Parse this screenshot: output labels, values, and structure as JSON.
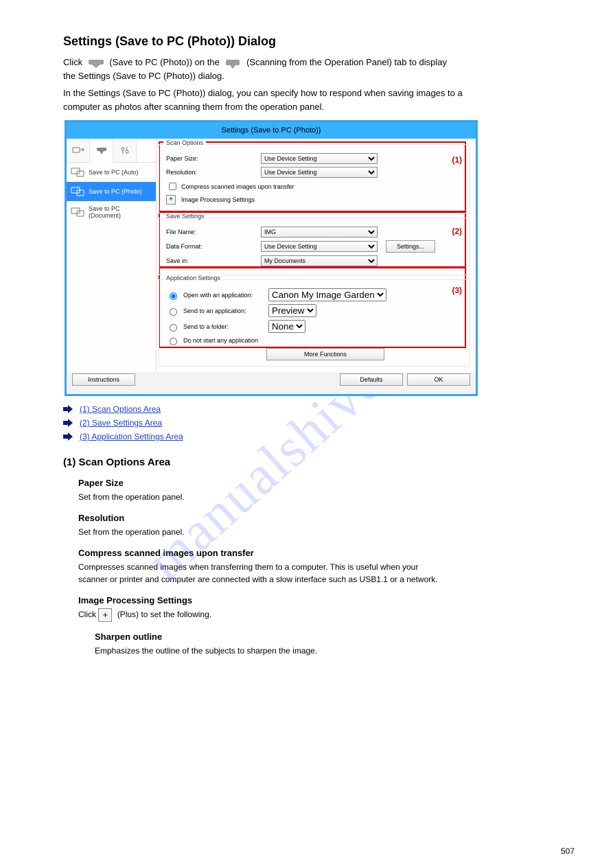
{
  "intro": {
    "line1_prefix": "Click ",
    "line1_mid": " (Save to PC (Photo)) on the ",
    "line1_end": " (Scanning from the Operation Panel) tab to display",
    "line2": "the Settings (Save to PC (Photo)) dialog.",
    "para2a": "In the Settings (Save to PC (Photo)) dialog, you can specify how to respond when saving images to a",
    "para2b": "computer as photos after scanning them from the operation panel."
  },
  "dialog": {
    "title": "Settings (Save to PC (Photo))",
    "sidebar": [
      {
        "label": "Save to PC (Auto)"
      },
      {
        "label": "Save to PC (Photo)"
      },
      {
        "label": "Save to PC (Document)"
      }
    ],
    "scan": {
      "legend": "Scan Options",
      "paperSizeLabel": "Paper Size:",
      "paperSize": "Use Device Setting",
      "resolutionLabel": "Resolution:",
      "resolution": "Use Device Setting",
      "compress": "Compress scanned images upon transfer",
      "imgproc": "Image Processing Settings"
    },
    "save": {
      "legend": "Save Settings",
      "fileNameLabel": "File Name:",
      "fileName": "IMG",
      "dataFormatLabel": "Data Format:",
      "dataFormat": "Use Device Setting",
      "settingsBtn": "Settings...",
      "saveInLabel": "Save in:",
      "saveIn": "My Documents"
    },
    "app": {
      "legend": "Application Settings",
      "openWithLabel": "Open with an application:",
      "openWith": "Canon My Image Garden",
      "sendAppLabel": "Send to an application:",
      "sendApp": "Preview",
      "sendFolderLabel": "Send to a folder:",
      "sendFolder": "None",
      "doNotStart": "Do not start any application",
      "moreFunctions": "More Functions"
    },
    "badge1": "(1)",
    "badge2": "(2)",
    "badge3": "(3)",
    "instructions": "Instructions",
    "defaults": "Defaults",
    "ok": "OK"
  },
  "links": {
    "b1": "(1) Scan Options Area",
    "b2": "(2) Save Settings Area",
    "b3": "(3) Application Settings Area"
  },
  "sections": {
    "scanArea": "(1) Scan Options Area",
    "paperSize": "Paper Size",
    "paperSizeDesc": "Set from the operation panel.",
    "resolution": "Resolution",
    "resolutionDesc": "Set from the operation panel.",
    "compressTitle": "Compress scanned images upon transfer",
    "compressDesc1": "Compresses scanned images when transferring them to a computer. This is useful when your",
    "compressDesc2": "scanner or printer and computer are connected with a slow interface such as USB1.1 or a network.",
    "imgprocTitle": "Image Processing Settings",
    "imgprocPrefix": "Click ",
    "imgprocMid": " (Plus) to set the following.",
    "sharpenTitle": "Sharpen outline",
    "sharpenDesc": "Emphasizes the outline of the subjects to sharpen the image."
  },
  "heading": "Settings (Save to PC (Photo)) Dialog",
  "watermark": "manualshive.com",
  "pageNum": "507"
}
